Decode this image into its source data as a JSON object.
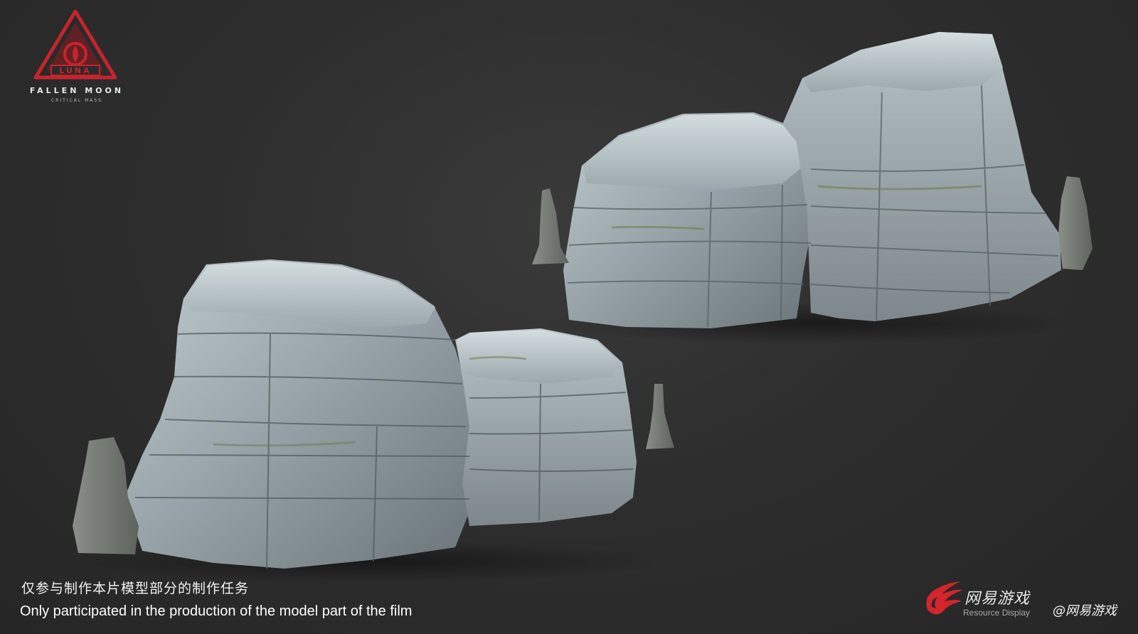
{
  "logo": {
    "title": "FALLEN MOON",
    "subtitle": "CRITICAL MASS",
    "brand_text": "LUNA",
    "brand_color": "#c8232c"
  },
  "caption": {
    "zh": "仅参与制作本片模型部分的制作任务",
    "en": "Only participated in the production of the model part of the film"
  },
  "publisher": {
    "name": "网易游戏",
    "subtitle": "Resource Display",
    "handle": "@网易游戏",
    "mark_color": "#d4242c"
  },
  "colors": {
    "background": "#2b2b2b",
    "rock_light": "#aeb9bd",
    "rock_mid": "#8f9ba0",
    "rock_dark": "#5f686d",
    "moss": "#6d7a4a"
  }
}
